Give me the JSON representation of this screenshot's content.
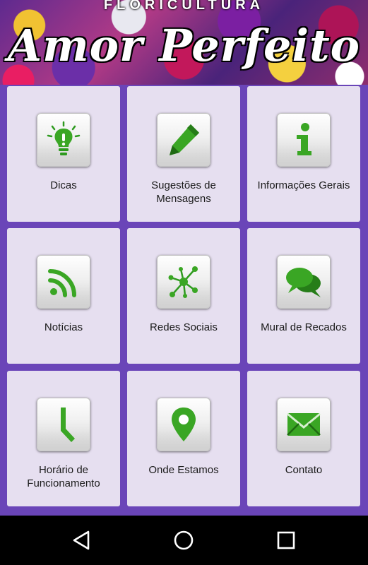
{
  "banner": {
    "subtitle": "FLORICULTURA",
    "title": "Amor Perfeito"
  },
  "tiles": [
    {
      "label": "Dicas",
      "icon": "lightbulb-icon"
    },
    {
      "label": "Sugestões de Mensagens",
      "icon": "pencil-icon"
    },
    {
      "label": "Informações Gerais",
      "icon": "info-icon"
    },
    {
      "label": "Notícias",
      "icon": "rss-icon"
    },
    {
      "label": "Redes Sociais",
      "icon": "network-icon"
    },
    {
      "label": "Mural de Recados",
      "icon": "chat-bubbles-icon"
    },
    {
      "label": "Horário de Funcionamento",
      "icon": "clock-icon"
    },
    {
      "label": "Onde Estamos",
      "icon": "location-pin-icon"
    },
    {
      "label": "Contato",
      "icon": "envelope-icon"
    }
  ],
  "colors": {
    "background": "#6a45b8",
    "tile": "#e6dff0",
    "icon_green": "#2e9a1f"
  },
  "navbar": {
    "back_icon": "triangle-back-icon",
    "home_icon": "circle-home-icon",
    "recents_icon": "square-recents-icon"
  }
}
